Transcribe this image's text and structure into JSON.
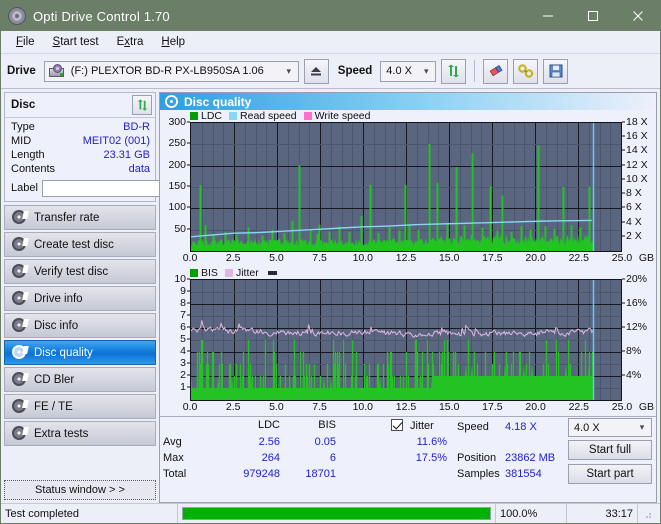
{
  "window": {
    "title": "Opti Drive Control 1.70",
    "icon": "disc-icon",
    "minimize": "—",
    "maximize": "□",
    "close": "✕"
  },
  "menubar": {
    "items": [
      {
        "label": "File",
        "accel": "F"
      },
      {
        "label": "Start test",
        "accel": "S"
      },
      {
        "label": "Extra",
        "accel": "x"
      },
      {
        "label": "Help",
        "accel": "H"
      }
    ]
  },
  "toolbar": {
    "drive_label": "Drive",
    "drive_value": "(F:)  PLEXTOR BD-R  PX-LB950SA 1.06",
    "eject_icon": "eject-icon",
    "speed_label": "Speed",
    "speed_value": "4.0 X",
    "refresh_icon": "refresh-icon",
    "erase_icon": "eraser-icon",
    "tools_icon": "tools-icon",
    "save_icon": "save-icon"
  },
  "sidebar": {
    "disc_panel": {
      "title": "Disc",
      "refresh_icon": "refresh-icon",
      "rows": [
        {
          "key": "Type",
          "value": "BD-R"
        },
        {
          "key": "MID",
          "value": "MEIT02 (001)"
        },
        {
          "key": "Length",
          "value": "23.31 GB"
        },
        {
          "key": "Contents",
          "value": "data"
        }
      ],
      "label_key": "Label",
      "label_value": "",
      "label_placeholder": "",
      "label_button_icon": "disc-icon"
    },
    "nav": [
      {
        "label": "Transfer rate",
        "active": false
      },
      {
        "label": "Create test disc",
        "active": false
      },
      {
        "label": "Verify test disc",
        "active": false
      },
      {
        "label": "Drive info",
        "active": false
      },
      {
        "label": "Disc info",
        "active": false
      },
      {
        "label": "Disc quality",
        "active": true
      },
      {
        "label": "CD Bler",
        "active": false
      },
      {
        "label": "FE / TE",
        "active": false
      },
      {
        "label": "Extra tests",
        "active": false
      }
    ],
    "status_window_button": "Status window > >"
  },
  "main": {
    "panel_title": "Disc quality",
    "panel_icon": "disc-icon"
  },
  "stats": {
    "col_ldc": "LDC",
    "col_bis": "BIS",
    "row_avg": "Avg",
    "row_max": "Max",
    "row_total": "Total",
    "ldc_avg": "2.56",
    "ldc_max": "264",
    "ldc_total": "979248",
    "bis_avg": "0.05",
    "bis_max": "6",
    "bis_total": "18701",
    "jitter_label": "Jitter",
    "jitter_checked": true,
    "jitter_avg": "11.6%",
    "jitter_max": "17.5%",
    "speed_label": "Speed",
    "speed_value": "4.18 X",
    "position_label": "Position",
    "position_value": "23862 MB",
    "samples_label": "Samples",
    "samples_value": "381554",
    "speed_select": "4.0 X",
    "start_full_button": "Start full",
    "start_part_button": "Start part"
  },
  "statusbar": {
    "message": "Test completed",
    "percent_text": "100.0%",
    "percent_value": 100,
    "time": "33:17"
  },
  "chart_data": [
    {
      "type": "line",
      "title": "LDC / Read speed",
      "xlabel": "GB",
      "ylabel": "LDC",
      "xlim": [
        0.0,
        25.0
      ],
      "xticks": [
        "0.0",
        "2.5",
        "5.0",
        "7.5",
        "10.0",
        "12.5",
        "15.0",
        "17.5",
        "20.0",
        "22.5",
        "25.0"
      ],
      "x_unit": "GB",
      "ylim": [
        0,
        300
      ],
      "yticks": [
        "50",
        "100",
        "150",
        "200",
        "250",
        "300"
      ],
      "y2lim": [
        0,
        18
      ],
      "y2ticks": [
        "2 X",
        "4 X",
        "6 X",
        "8 X",
        "10 X",
        "12 X",
        "14 X",
        "16 X",
        "18 X"
      ],
      "grid": true,
      "legend": [
        {
          "name": "LDC",
          "color": "#00a000"
        },
        {
          "name": "Read speed",
          "color": "#87d7f2"
        },
        {
          "name": "Write speed",
          "color": "#ff6ecb"
        }
      ],
      "plot_bg": "#5a6580",
      "data_end_gb": 23.4,
      "ldc_baseline": 12,
      "ldc_spikes": [
        [
          0.55,
          154
        ],
        [
          0.8,
          60
        ],
        [
          1.3,
          40
        ],
        [
          2.0,
          45
        ],
        [
          2.6,
          38
        ],
        [
          3.3,
          55
        ],
        [
          4.1,
          36
        ],
        [
          4.7,
          50
        ],
        [
          5.4,
          42
        ],
        [
          5.9,
          70
        ],
        [
          6.3,
          201
        ],
        [
          6.9,
          48
        ],
        [
          7.3,
          40
        ],
        [
          7.45,
          62
        ],
        [
          8.0,
          46
        ],
        [
          8.6,
          58
        ],
        [
          9.2,
          44
        ],
        [
          9.9,
          82
        ],
        [
          10.4,
          155
        ],
        [
          10.9,
          42
        ],
        [
          11.5,
          55
        ],
        [
          12.1,
          48
        ],
        [
          12.45,
          155
        ],
        [
          12.7,
          60
        ],
        [
          13.2,
          50
        ],
        [
          13.85,
          251
        ],
        [
          14.3,
          160
        ],
        [
          14.9,
          66
        ],
        [
          15.4,
          197
        ],
        [
          15.9,
          60
        ],
        [
          16.35,
          229
        ],
        [
          16.9,
          55
        ],
        [
          17.4,
          152
        ],
        [
          17.8,
          48
        ],
        [
          18.1,
          130
        ],
        [
          18.6,
          45
        ],
        [
          19.2,
          58
        ],
        [
          19.7,
          50
        ],
        [
          20.15,
          247
        ],
        [
          20.6,
          58
        ],
        [
          21.1,
          52
        ],
        [
          21.65,
          150
        ],
        [
          22.1,
          60
        ],
        [
          22.6,
          55
        ],
        [
          23.15,
          151
        ]
      ],
      "read_speed_curve": [
        [
          0.0,
          2.0
        ],
        [
          1.0,
          2.2
        ],
        [
          2.5,
          2.5
        ],
        [
          4.0,
          2.6
        ],
        [
          5.5,
          2.8
        ],
        [
          7.0,
          3.0
        ],
        [
          8.5,
          3.2
        ],
        [
          10.0,
          3.4
        ],
        [
          11.5,
          3.5
        ],
        [
          13.0,
          3.7
        ],
        [
          14.5,
          3.8
        ],
        [
          16.0,
          3.9
        ],
        [
          17.5,
          4.0
        ],
        [
          19.0,
          4.1
        ],
        [
          20.5,
          4.2
        ],
        [
          21.5,
          4.25
        ],
        [
          23.3,
          4.3
        ]
      ],
      "cursor_gb": 23.4
    },
    {
      "type": "line",
      "title": "BIS / Jitter",
      "xlabel": "GB",
      "ylabel": "BIS",
      "xlim": [
        0.0,
        25.0
      ],
      "xticks": [
        "0.0",
        "2.5",
        "5.0",
        "7.5",
        "10.0",
        "12.5",
        "15.0",
        "17.5",
        "20.0",
        "22.5",
        "25.0"
      ],
      "x_unit": "GB",
      "ylim": [
        0,
        10
      ],
      "yticks": [
        "1",
        "2",
        "3",
        "4",
        "5",
        "6",
        "7",
        "8",
        "9",
        "10"
      ],
      "y2lim": [
        0,
        20
      ],
      "y2ticks": [
        "4%",
        "8%",
        "12%",
        "16%",
        "20%"
      ],
      "grid": true,
      "legend": [
        {
          "name": "BIS",
          "color": "#00a000"
        },
        {
          "name": "Jitter",
          "color": "#dfb6e0"
        }
      ],
      "plot_bg": "#5a6580",
      "data_end_gb": 23.4,
      "bis_baseline": 1,
      "bis_baseline_step_gb": 14.0,
      "bis_baseline_after": 2,
      "jitter_mean_pct": 11.6,
      "jitter_max_pct": 17.5,
      "cursor_gb": 23.4
    }
  ]
}
